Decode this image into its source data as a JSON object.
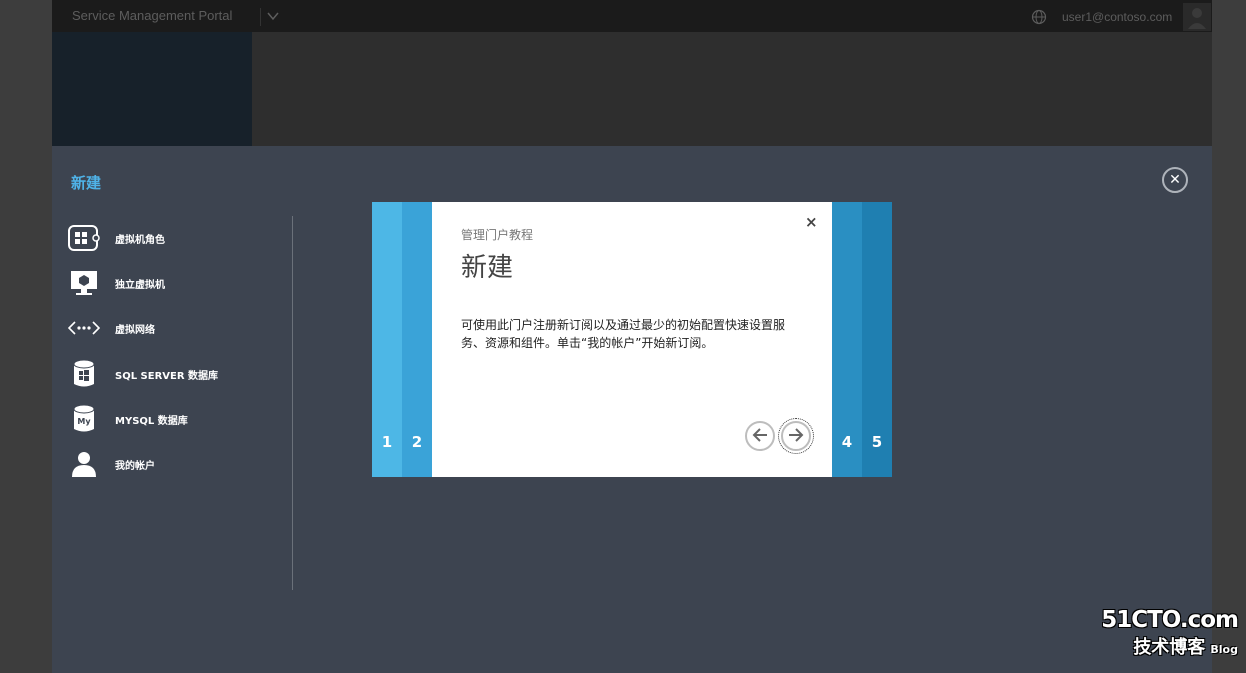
{
  "portal": {
    "title": "Service Management Portal",
    "user": "user1@contoso.com"
  },
  "drawer": {
    "title": "新建",
    "items": [
      {
        "label": "虚拟机角色",
        "icon": "vm-role-icon"
      },
      {
        "label": "独立虚拟机",
        "icon": "standalone-vm-icon"
      },
      {
        "label": "虚拟网络",
        "icon": "virtual-network-icon"
      },
      {
        "label": "SQL SERVER 数据库",
        "icon": "sql-server-database-icon"
      },
      {
        "label": "MYSQL 数据库",
        "icon": "mysql-database-icon"
      },
      {
        "label": "我的帐户",
        "icon": "user-account-icon"
      }
    ]
  },
  "tutorial": {
    "subtitle": "管理门户教程",
    "heading": "新建",
    "body": "可使用此门户注册新订阅以及通过最少的初始配置快速设置服务、资源和组件。单击“我的帐户”开始新订阅。",
    "close": "×",
    "pages": [
      "1",
      "2",
      "4",
      "5"
    ]
  },
  "watermark": {
    "site": "51CTO.com",
    "tagline": "技术博客",
    "blog": "Blog"
  },
  "colors": {
    "accent": "#4fb3e8",
    "drawer_bg": "#3d4450",
    "strip1": "#4db7e6",
    "strip2": "#3aa3d8",
    "strip4": "#2a8fc2",
    "strip5": "#1f7fb1"
  }
}
